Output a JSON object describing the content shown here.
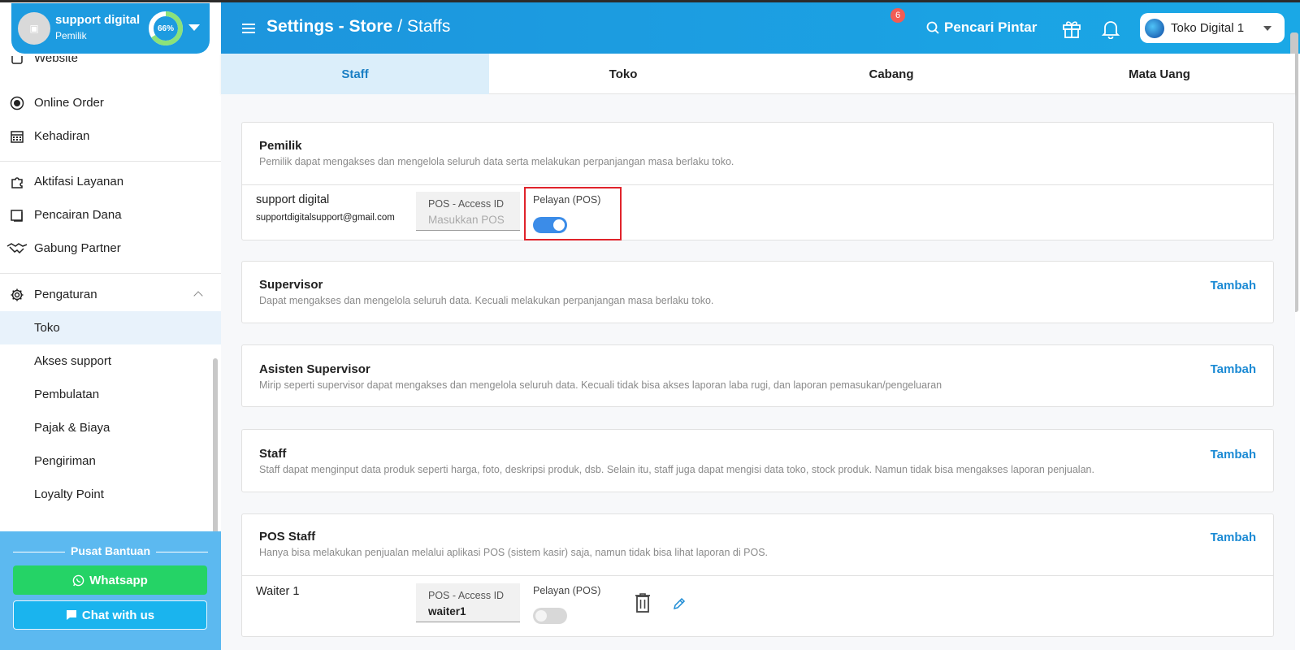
{
  "profile": {
    "avatar_glyph": "▣",
    "name": "support digital",
    "role": "Pemilik",
    "progress_percent": 66,
    "progress_label": "66%"
  },
  "sidebar": {
    "items": [
      {
        "label": "Website",
        "icon": "website-icon"
      },
      {
        "label": "Online Order",
        "icon": "online-order-icon"
      },
      {
        "label": "Kehadiran",
        "icon": "calendar-icon"
      },
      {
        "label": "Aktifasi Layanan",
        "icon": "puzzle-icon"
      },
      {
        "label": "Pencairan Dana",
        "icon": "wallet-icon"
      },
      {
        "label": "Gabung Partner",
        "icon": "handshake-icon"
      },
      {
        "label": "Pengaturan",
        "icon": "gear-icon"
      },
      {
        "label": "Toko"
      },
      {
        "label": "Akses support"
      },
      {
        "label": "Pembulatan"
      },
      {
        "label": "Pajak & Biaya"
      },
      {
        "label": "Pengiriman"
      },
      {
        "label": "Loyalty Point"
      }
    ]
  },
  "help": {
    "title": "Pusat Bantuan",
    "whatsapp_label": "Whatsapp",
    "chat_label": "Chat with us"
  },
  "header": {
    "breadcrumb_main": "Settings - Store",
    "breadcrumb_sep": "/",
    "breadcrumb_sub": "Staffs",
    "search_label": "Pencari Pintar",
    "notification_count": "6",
    "store_name": "Toko Digital 1"
  },
  "tabs": [
    {
      "label": "Staff",
      "active": true
    },
    {
      "label": "Toko",
      "active": false
    },
    {
      "label": "Cabang",
      "active": false
    },
    {
      "label": "Mata Uang",
      "active": false
    }
  ],
  "sections": {
    "owner": {
      "title": "Pemilik",
      "desc": "Pemilik dapat mengakses dan mengelola seluruh data serta melakukan perpanjangan masa berlaku toko.",
      "member_name": "support digital",
      "member_email": "supportdigitalsupport@gmail.com",
      "pos_label": "POS - Access ID",
      "pos_placeholder": "Masukkan POS",
      "pelayan_label": "Pelayan (POS)",
      "pelayan_on": true
    },
    "supervisor": {
      "title": "Supervisor",
      "desc": "Dapat mengakses dan mengelola seluruh data. Kecuali melakukan perpanjangan masa berlaku toko.",
      "add_label": "Tambah"
    },
    "assistant": {
      "title": "Asisten Supervisor",
      "desc": "Mirip seperti supervisor dapat mengakses dan mengelola seluruh data. Kecuali tidak bisa akses laporan laba rugi, dan laporan pemasukan/pengeluaran",
      "add_label": "Tambah"
    },
    "staff": {
      "title": "Staff",
      "desc": "Staff dapat menginput data produk seperti harga, foto, deskripsi produk, dsb. Selain itu, staff juga dapat mengisi data toko, stock produk. Namun tidak bisa mengakses laporan penjualan.",
      "add_label": "Tambah"
    },
    "pos_staff": {
      "title": "POS Staff",
      "desc": "Hanya bisa melakukan penjualan melalui aplikasi POS (sistem kasir) saja, namun tidak bisa lihat laporan di POS.",
      "add_label": "Tambah",
      "member_name": "Waiter 1",
      "pos_label": "POS - Access ID",
      "pos_value": "waiter1",
      "pelayan_label": "Pelayan (POS)",
      "pelayan_on": false
    }
  },
  "colors": {
    "header_blue": "#1d9be0",
    "accent_link": "#1b8ad4",
    "whatsapp_green": "#25d366",
    "highlight_red": "#e0232b",
    "toggle_on": "#3b8ce8"
  }
}
